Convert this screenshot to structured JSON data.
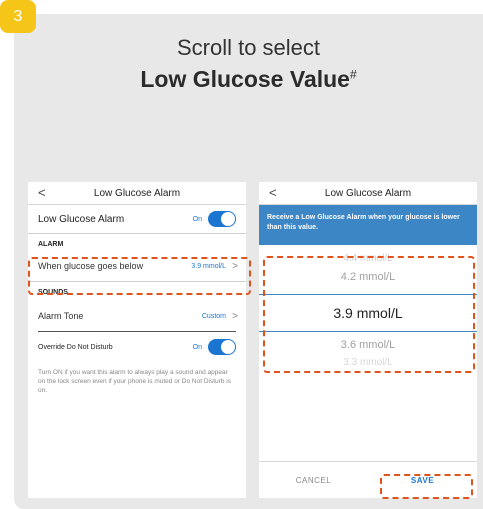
{
  "step": {
    "number": "3"
  },
  "heading": {
    "line1": "Scroll to select",
    "line2": "Low Glucose Value",
    "footnote_mark": "#"
  },
  "left_screen": {
    "nav_back": "<",
    "title": "Low Glucose Alarm",
    "main_row": {
      "label": "Low Glucose Alarm",
      "state": "On"
    },
    "alarm_section": {
      "header": "ALARM",
      "row": {
        "label": "When glucose goes below",
        "value": "3.9 mmol/L",
        "chevron": ">"
      }
    },
    "sounds_section": {
      "header": "SOUNDS",
      "tone_row": {
        "label": "Alarm Tone",
        "value": "Custom",
        "chevron": ">"
      },
      "dnd_row": {
        "label": "Override Do Not Disturb",
        "state": "On"
      },
      "helper": "Turn ON if you want this alarm to always play a sound and appear on the lock screen even if your phone is muted or Do Not Disturb is on."
    }
  },
  "right_screen": {
    "nav_back": "<",
    "title": "Low Glucose Alarm",
    "banner": "Receive a Low Glucose Alarm when your glucose is lower than this value.",
    "picker": {
      "options": [
        "4.4 mmol/L",
        "4.2 mmol/L",
        "3.9 mmol/L",
        "3.6 mmol/L",
        "3.3 mmol/L"
      ],
      "selected": "3.9 mmol/L"
    },
    "cancel_label": "CANCEL",
    "save_label": "SAVE"
  },
  "colors": {
    "accent": "#1b76d2",
    "banner": "#3d86c6",
    "highlight": "#e0531a",
    "badge": "#f5c518"
  },
  "icons": {
    "back": "chevron-left-icon",
    "row_chevron": "chevron-right-icon",
    "toggle": "toggle-switch"
  }
}
